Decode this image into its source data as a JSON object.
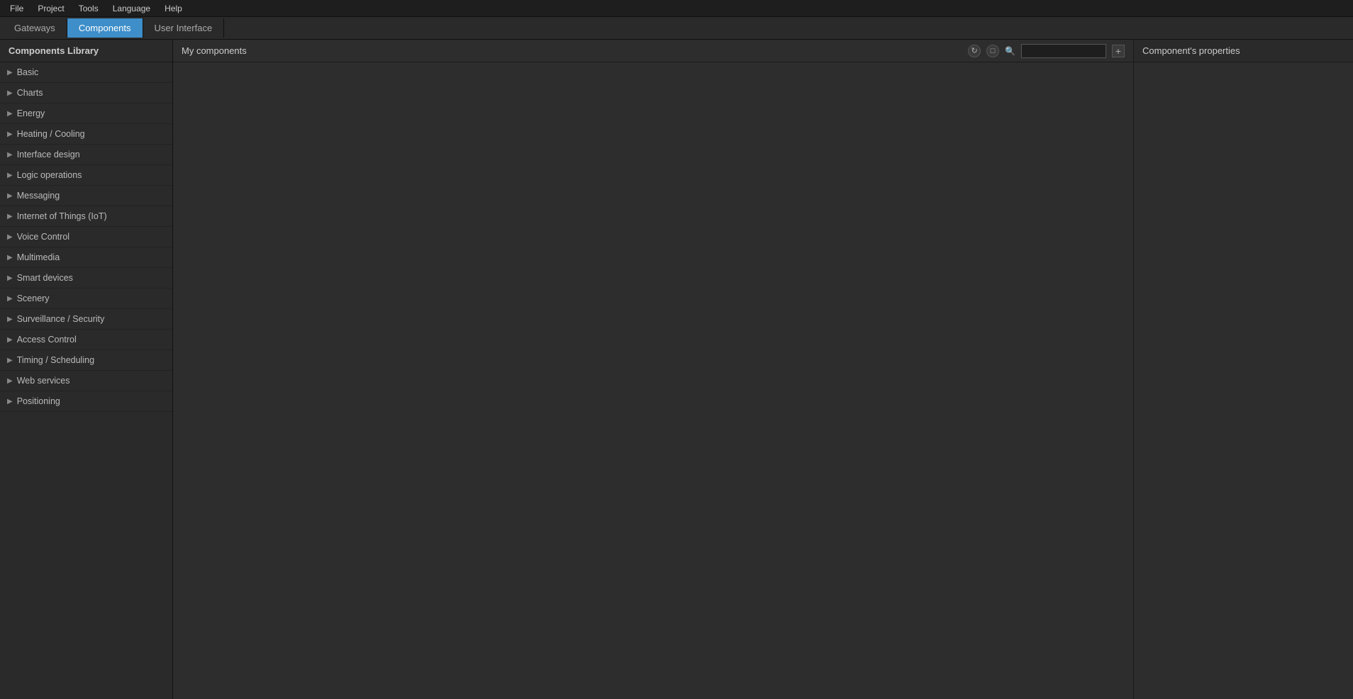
{
  "menubar": {
    "items": [
      {
        "label": "File",
        "name": "file-menu"
      },
      {
        "label": "Project",
        "name": "project-menu"
      },
      {
        "label": "Tools",
        "name": "tools-menu"
      },
      {
        "label": "Language",
        "name": "language-menu"
      },
      {
        "label": "Help",
        "name": "help-menu"
      }
    ]
  },
  "tabbar": {
    "tabs": [
      {
        "label": "Gateways",
        "name": "tab-gateways",
        "active": false
      },
      {
        "label": "Components",
        "name": "tab-components",
        "active": true
      },
      {
        "label": "User Interface",
        "name": "tab-user-interface",
        "active": false
      }
    ]
  },
  "sidebar": {
    "title": "Components Library",
    "items": [
      {
        "label": "Basic",
        "name": "sidebar-item-basic"
      },
      {
        "label": "Charts",
        "name": "sidebar-item-charts"
      },
      {
        "label": "Energy",
        "name": "sidebar-item-energy"
      },
      {
        "label": "Heating / Cooling",
        "name": "sidebar-item-heating-cooling"
      },
      {
        "label": "Interface design",
        "name": "sidebar-item-interface-design"
      },
      {
        "label": "Logic operations",
        "name": "sidebar-item-logic-operations"
      },
      {
        "label": "Messaging",
        "name": "sidebar-item-messaging"
      },
      {
        "label": "Internet of Things (IoT)",
        "name": "sidebar-item-iot"
      },
      {
        "label": "Voice Control",
        "name": "sidebar-item-voice-control"
      },
      {
        "label": "Multimedia",
        "name": "sidebar-item-multimedia"
      },
      {
        "label": "Smart devices",
        "name": "sidebar-item-smart-devices"
      },
      {
        "label": "Scenery",
        "name": "sidebar-item-scenery"
      },
      {
        "label": "Surveillance / Security",
        "name": "sidebar-item-surveillance-security"
      },
      {
        "label": "Access Control",
        "name": "sidebar-item-access-control"
      },
      {
        "label": "Timing / Scheduling",
        "name": "sidebar-item-timing-scheduling"
      },
      {
        "label": "Web services",
        "name": "sidebar-item-web-services"
      },
      {
        "label": "Positioning",
        "name": "sidebar-item-positioning"
      }
    ]
  },
  "center": {
    "title": "My components",
    "search_placeholder": "",
    "refresh_icon": "↺",
    "close_icon": "×",
    "add_icon": "+"
  },
  "rightpanel": {
    "title": "Component's properties"
  }
}
